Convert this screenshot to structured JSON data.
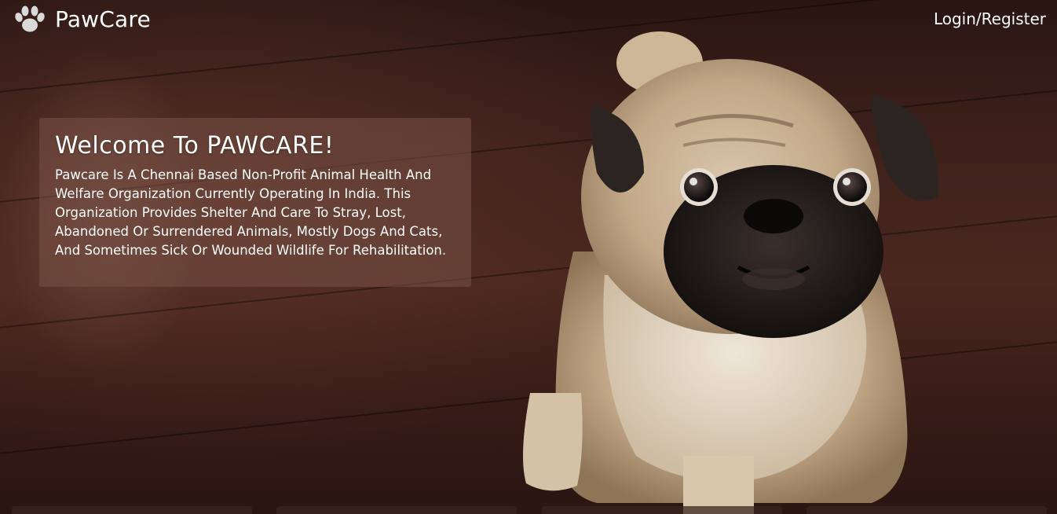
{
  "brand": {
    "name": "PawCare",
    "icon": "paw-icon"
  },
  "nav": {
    "login_label": "Login/Register"
  },
  "welcome": {
    "title": "Welcome To PAWCARE!",
    "body": "Pawcare Is A Chennai Based Non-Profit Animal Health And Welfare Organization Currently Operating In India. This Organization Provides Shelter And Care To Stray, Lost, Abandoned Or Surrendered Animals, Mostly Dogs And Cats, And Sometimes Sick Or Wounded Wildlife For Rehabilitation."
  },
  "hero_image": "pug-photo",
  "colors": {
    "text": "#ffffff",
    "panel": "#7a5046",
    "background": "#3f211b"
  }
}
